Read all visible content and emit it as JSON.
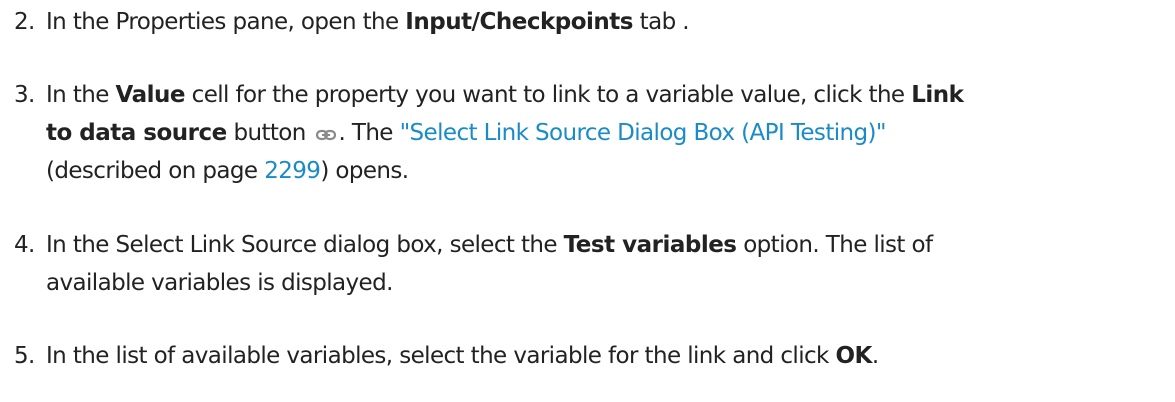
{
  "steps": [
    {
      "number": "2.",
      "lines": [
        [
          {
            "text": "In the Properties pane, open the ",
            "style": "normal"
          },
          {
            "text": "Input/Checkpoints",
            "style": "bold"
          },
          {
            "text": " tab .",
            "style": "normal"
          }
        ]
      ]
    },
    {
      "number": "3.",
      "lines": [
        [
          {
            "text": "In the ",
            "style": "normal"
          },
          {
            "text": "Value",
            "style": "bold"
          },
          {
            "text": " cell for the property you want to link to a variable value, click the ",
            "style": "normal"
          },
          {
            "text": "Link",
            "style": "bold"
          }
        ],
        [
          {
            "text": "to data source",
            "style": "bold"
          },
          {
            "text": " button ",
            "style": "normal"
          },
          {
            "icon": "link-chain-icon"
          },
          {
            "text": ". The ",
            "style": "normal"
          },
          {
            "text": "\"Select Link Source Dialog Box (API Testing)\"",
            "style": "link"
          }
        ],
        [
          {
            "text": "(described on page ",
            "style": "normal"
          },
          {
            "text": "2299",
            "style": "link"
          },
          {
            "text": ") opens.",
            "style": "normal"
          }
        ]
      ]
    },
    {
      "number": "4.",
      "lines": [
        [
          {
            "text": "In the Select Link Source dialog box, select the ",
            "style": "normal"
          },
          {
            "text": "Test variables",
            "style": "bold"
          },
          {
            "text": " option. The list of",
            "style": "normal"
          }
        ],
        [
          {
            "text": "available variables is displayed.",
            "style": "normal"
          }
        ]
      ]
    },
    {
      "number": "5.",
      "lines": [
        [
          {
            "text": "In the list of available variables, select the variable for the link and click ",
            "style": "normal"
          },
          {
            "text": "OK",
            "style": "bold"
          },
          {
            "text": ".",
            "style": "normal"
          }
        ]
      ]
    }
  ],
  "colors": {
    "text": "#222222",
    "link": "#1a8bc9",
    "icon": "#8a8a8a"
  }
}
